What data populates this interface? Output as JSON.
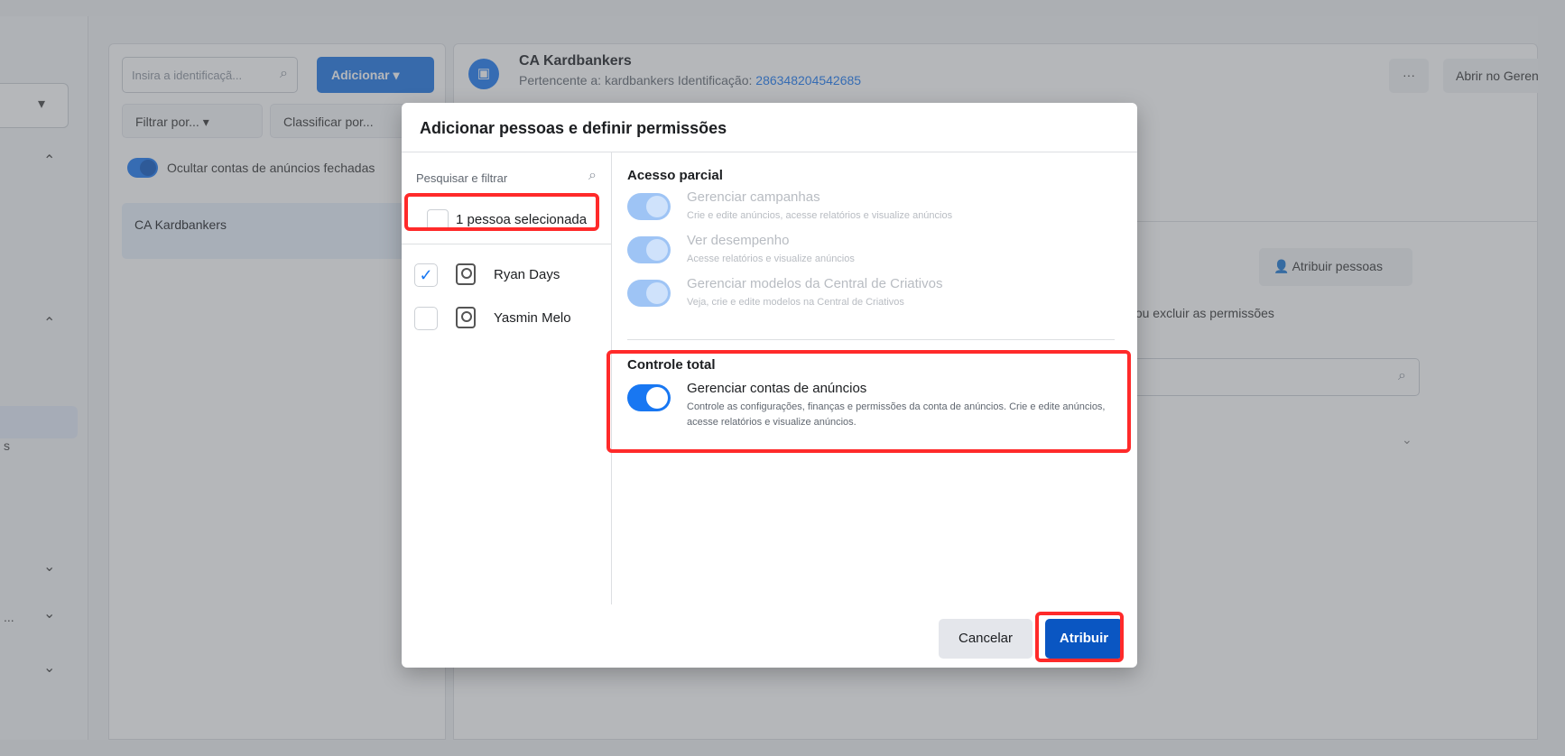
{
  "left_nav": {
    "truncated_label_1": "s",
    "truncated_label_2": "..."
  },
  "middle": {
    "search_placeholder": "Insira a identificaçã...",
    "add_button": "Adicionar",
    "filter_label": "Filtrar por...",
    "sort_label": "Classificar por...",
    "hide_closed_label": "Ocultar contas de anúncios fechadas",
    "account_item": "CA Kardbankers"
  },
  "account": {
    "name": "CA Kardbankers",
    "owner_prefix": "Pertencente a: kardbankers  Identificação: ",
    "id": "286348204542685",
    "more_label": "···",
    "open_label": "Abrir no Gerenciador",
    "assign_people_label": "Atribuir pessoas",
    "permission_text": "de ver, editar ou excluir as permissões"
  },
  "modal": {
    "title": "Adicionar pessoas e definir permissões",
    "search_placeholder": "Pesquisar e filtrar",
    "selected_count": "1 pessoa selecionada",
    "people": [
      {
        "name": "Ryan Days",
        "checked": true
      },
      {
        "name": "Yasmin Melo",
        "checked": false
      }
    ],
    "partial_section": "Acesso parcial",
    "partial_permissions": [
      {
        "title": "Gerenciar campanhas",
        "desc": "Crie e edite anúncios, acesse relatórios e visualize anúncios"
      },
      {
        "title": "Ver desempenho",
        "desc": "Acesse relatórios e visualize anúncios"
      },
      {
        "title": "Gerenciar modelos da Central de Criativos",
        "desc": "Veja, crie e edite modelos na Central de Criativos"
      }
    ],
    "full_section": "Controle total",
    "full_permission": {
      "title": "Gerenciar contas de anúncios",
      "desc": "Controle as configurações, finanças e permissões da conta de anúncios. Crie e edite anúncios, acesse relatórios e visualize anúncios."
    },
    "cancel_label": "Cancelar",
    "assign_label": "Atribuir"
  },
  "icons": {
    "check": "check-icon",
    "search": "search-icon",
    "person": "person-icon",
    "chevron": "chevron-down-icon",
    "accent": "#1877f2",
    "highlight": "#ff2a2a"
  }
}
